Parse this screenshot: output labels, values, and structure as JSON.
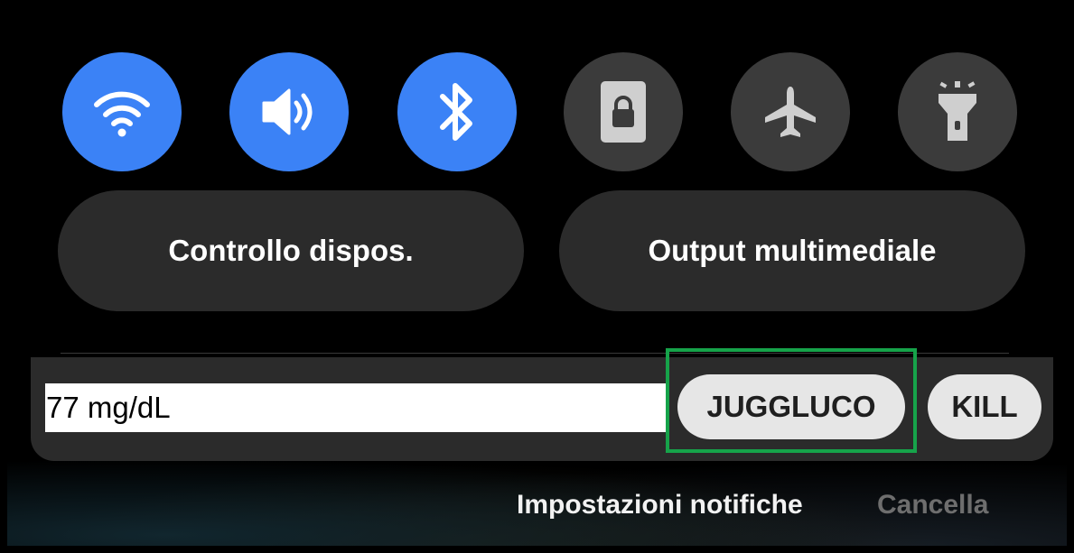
{
  "quick_settings": {
    "tiles": [
      {
        "name": "wifi",
        "icon": "wifi-icon",
        "state": "on"
      },
      {
        "name": "sound",
        "icon": "volume-icon",
        "state": "on"
      },
      {
        "name": "bluetooth",
        "icon": "bluetooth-icon",
        "state": "on"
      },
      {
        "name": "rotation-lock",
        "icon": "lock-icon",
        "state": "off"
      },
      {
        "name": "airplane-mode",
        "icon": "airplane-icon",
        "state": "off"
      },
      {
        "name": "flashlight",
        "icon": "flashlight-icon",
        "state": "off"
      }
    ],
    "device_control_label": "Controllo dispos.",
    "media_output_label": "Output multimediale"
  },
  "notification": {
    "glucose_value": "77 mg/dL",
    "juggluco_label": "JUGGLUCO",
    "kill_label": "KILL"
  },
  "footer": {
    "settings_label": "Impostazioni notifiche",
    "clear_label": "Cancella"
  },
  "colors": {
    "tile_on": "#3b82f6",
    "tile_off": "#3b3b3b",
    "highlight": "#16a34a"
  }
}
